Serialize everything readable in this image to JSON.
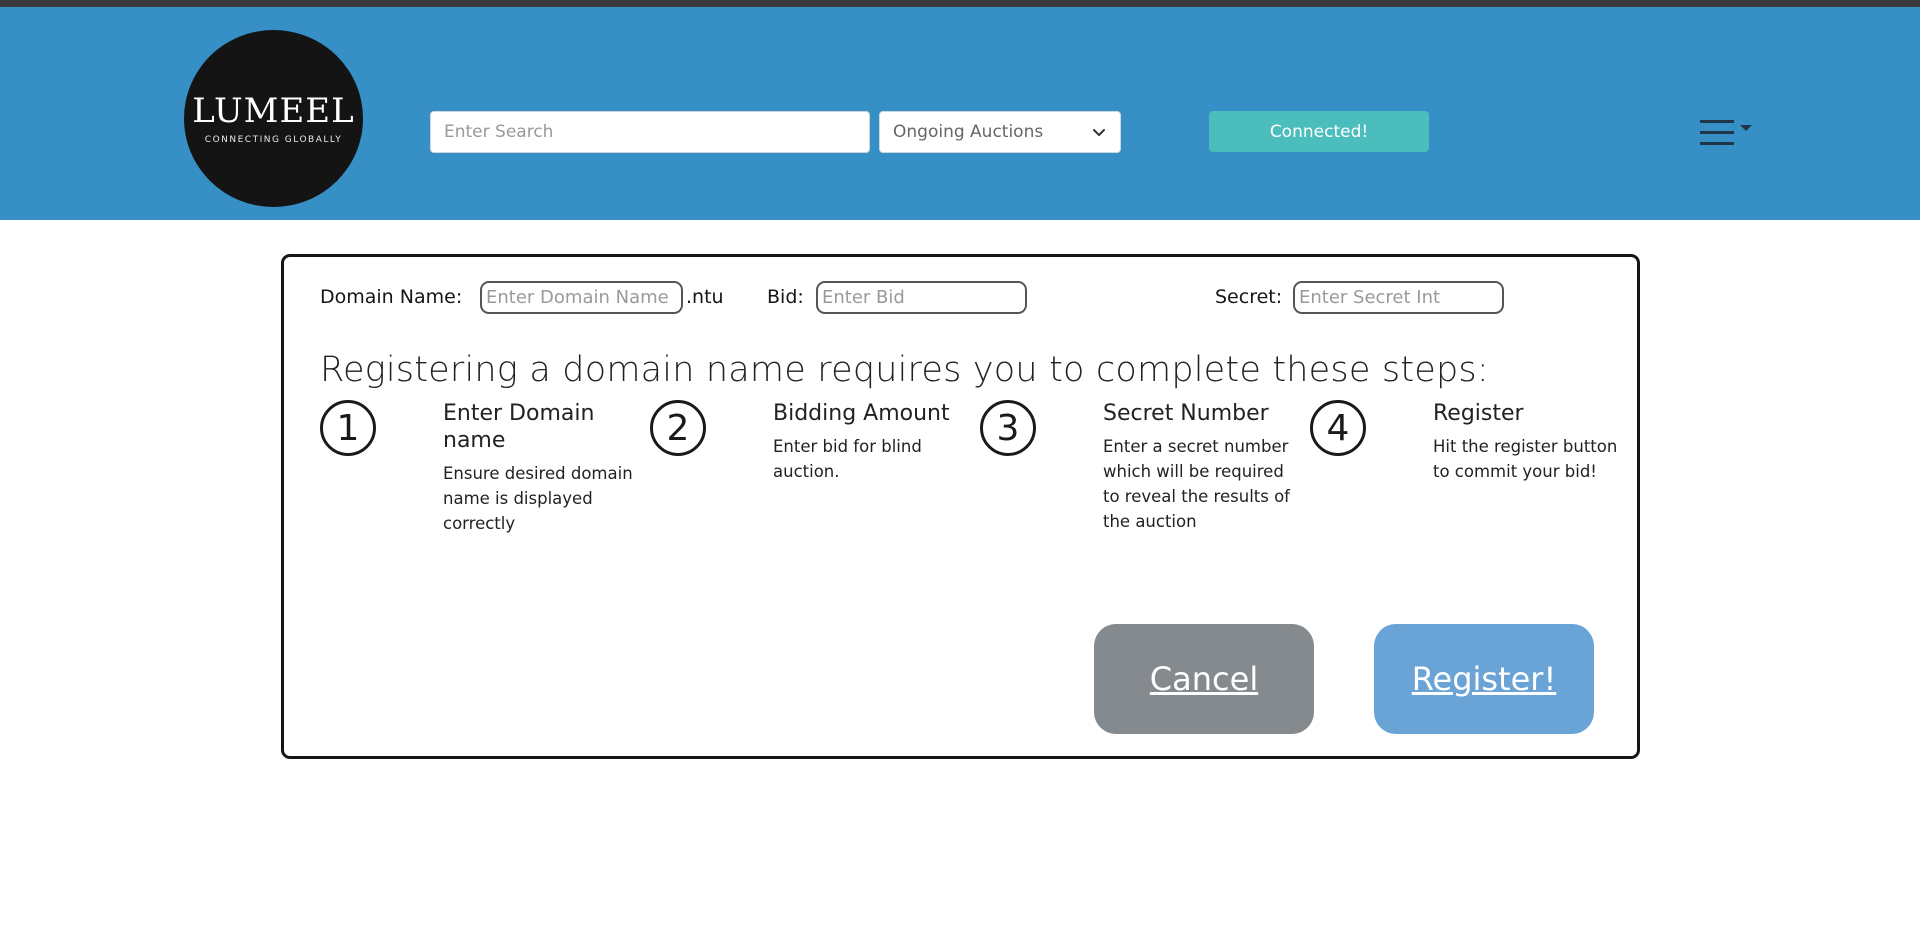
{
  "header": {
    "logo_word": "LUMEEL",
    "logo_tagline": "CONNECTING GLOBALLY",
    "search_placeholder": "Enter Search",
    "filter_select": {
      "value": "Ongoing Auctions"
    },
    "status_button": "Connected!",
    "menu_icon": "hamburger-icon"
  },
  "form": {
    "domain_label": "Domain Name:",
    "domain_placeholder": "Enter Domain Name",
    "domain_suffix": ".ntu",
    "bid_label": "Bid:",
    "bid_placeholder": "Enter Bid",
    "secret_label": "Secret:",
    "secret_placeholder": "Enter Secret Int"
  },
  "steps_title": "Registering a domain name requires you to complete these steps:",
  "steps": [
    {
      "number": "1",
      "title": "Enter Domain name",
      "desc": "Ensure desired domain name is displayed correctly"
    },
    {
      "number": "2",
      "title": "Bidding Amount",
      "desc": "Enter bid for blind auction."
    },
    {
      "number": "3",
      "title": "Secret Number",
      "desc": "Enter a secret number which will be required to reveal the results of the auction"
    },
    {
      "number": "4",
      "title": "Register",
      "desc": "Hit the register button to commit your bid!"
    }
  ],
  "actions": {
    "cancel_label": "Cancel",
    "register_label": "Register!"
  },
  "colors": {
    "header_bg": "#368fc5",
    "connected_bg": "#4cbdbd",
    "cancel_bg": "#858a8e",
    "register_bg": "#6aa3d6"
  }
}
